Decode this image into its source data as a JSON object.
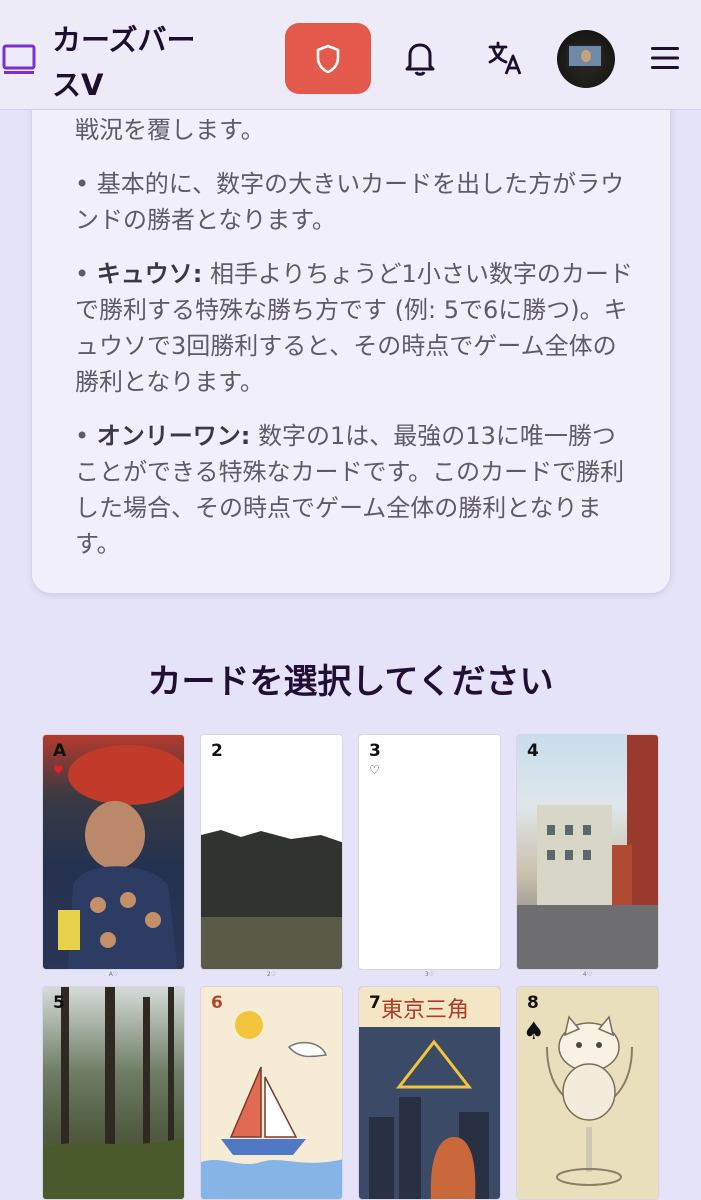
{
  "header": {
    "title": "カーズバースV",
    "icons": [
      "logo-icon",
      "shield-icon",
      "bell-icon",
      "translate-icon",
      "avatar",
      "menu-icon"
    ],
    "accent_color": "#e35a4c"
  },
  "rules": {
    "intro_tail": "戦況を覆します。",
    "rule1": "• 基本的に、数字の大きいカードを出した方がラウンドの勝者となります。",
    "rule2_bullet": "• ",
    "rule2_title": "キュウソ:",
    "rule2_text": " 相手よりちょうど1小さい数字のカードで勝利する特殊な勝ち方です (例: 5で6に勝つ)。キュウソで3回勝利すると、その時点でゲーム全体の勝利となります。",
    "rule3_bullet": "• ",
    "rule3_title": "オンリーワン:",
    "rule3_text": " 数字の1は、最強の13に唯一勝つことができる特殊なカードです。このカードで勝利した場合、その時点でゲーム全体の勝利となります。"
  },
  "section_title": "カードを選択してください",
  "cards": [
    {
      "rank": "A",
      "suit": "♥",
      "caption": "A♡"
    },
    {
      "rank": "2",
      "suit": "",
      "caption": "2♡"
    },
    {
      "rank": "3",
      "suit": "♡",
      "caption": "3♡"
    },
    {
      "rank": "4",
      "suit": "",
      "caption": "4♡"
    },
    {
      "rank": "5",
      "suit": "",
      "caption": ""
    },
    {
      "rank": "6",
      "suit": "",
      "caption": ""
    },
    {
      "rank": "7",
      "suit": "",
      "caption": "",
      "banner": "東京三角"
    },
    {
      "rank": "8",
      "suit": "♠",
      "caption": ""
    }
  ]
}
